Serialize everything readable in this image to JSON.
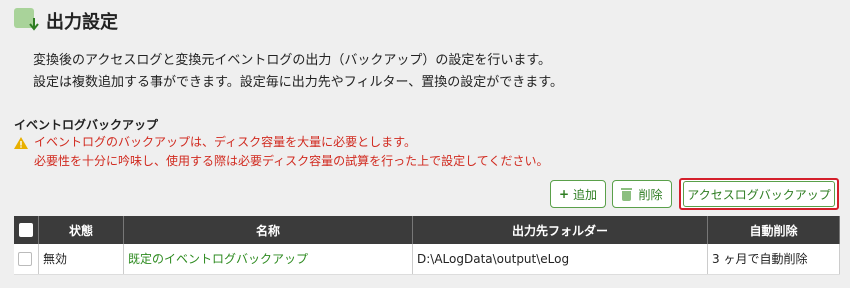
{
  "header": {
    "title": "出力設定",
    "icon": "output-download-icon"
  },
  "description": {
    "line1": "変換後のアクセスログと変換元イベントログの出力（バックアップ）の設定を行います。",
    "line2": "設定は複数追加する事ができます。設定毎に出力先やフィルター、置換の設定ができます。"
  },
  "section": {
    "title": "イベントログバックアップ"
  },
  "warning": {
    "line1": "イベントログのバックアップは、ディスク容量を大量に必要とします。",
    "line2": "必要性を十分に吟味し、使用する際は必要ディスク容量の試算を行った上で設定してください。",
    "color": "#d12a1f"
  },
  "toolbar": {
    "add_label": "追加",
    "delete_label": "削除",
    "backup_label": "アクセスログバックアップ"
  },
  "table": {
    "columns": [
      "状態",
      "名称",
      "出力先フォルダー",
      "自動削除"
    ],
    "rows": [
      {
        "status": "無効",
        "name": "既定のイベントログバックアップ",
        "folder": "D:\\ALogData\\output\\eLog",
        "auto_delete": "3 ヶ月で自動削除"
      }
    ]
  },
  "colors": {
    "accent": "#2e7d22",
    "highlight_border": "#d41f2b",
    "header_bg": "#3b3b3b"
  }
}
